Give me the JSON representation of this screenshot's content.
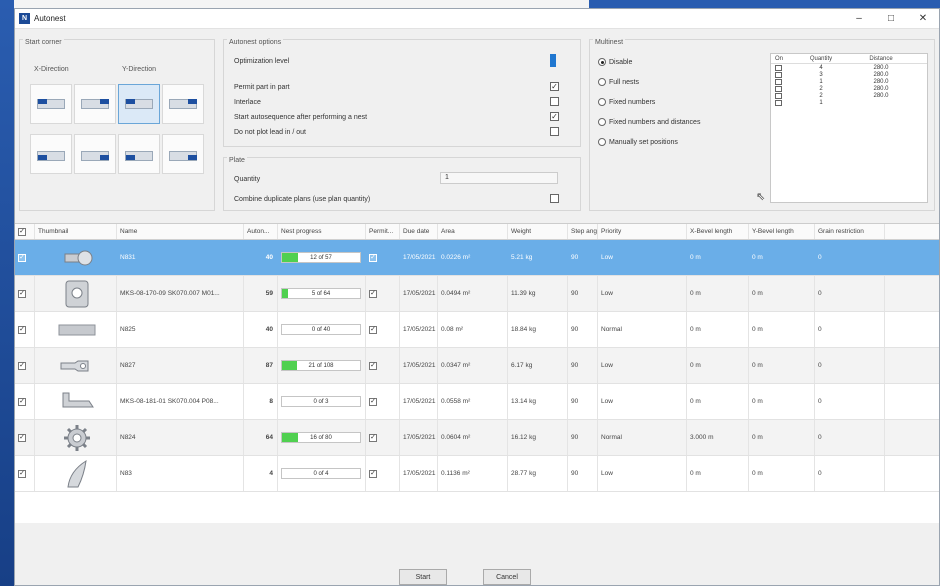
{
  "window": {
    "title": "Autonest",
    "icon_text": "N",
    "minimize": "–",
    "maximize": "□",
    "close": "✕"
  },
  "start_corner": {
    "label": "Start corner",
    "x_label": "X-Direction",
    "y_label": "Y-Direction"
  },
  "autonest_options": {
    "label": "Autonest options",
    "optimization_label": "Optimization level",
    "options": [
      {
        "label": "Permit part in part",
        "checked": true
      },
      {
        "label": "Interlace",
        "checked": false
      },
      {
        "label": "Start autosequence after performing a nest",
        "checked": true
      },
      {
        "label": "Do not plot lead in / out",
        "checked": false
      }
    ]
  },
  "plate": {
    "label": "Plate",
    "quantity_label": "Quantity",
    "quantity_value": "1",
    "combine_label": "Combine duplicate plans (use plan quantity)",
    "combine_checked": false
  },
  "multinest": {
    "label": "Multinest",
    "options": [
      {
        "label": "Disable",
        "selected": true
      },
      {
        "label": "Full nests",
        "selected": false
      },
      {
        "label": "Fixed numbers",
        "selected": false
      },
      {
        "label": "Fixed numbers and distances",
        "selected": false
      },
      {
        "label": "Manually set positions",
        "selected": false
      }
    ],
    "table": {
      "headers": [
        "On",
        "Quantity",
        "Distance"
      ],
      "rows": [
        {
          "qty": "4",
          "dist": "280.0"
        },
        {
          "qty": "3",
          "dist": "280.0"
        },
        {
          "qty": "1",
          "dist": "280.0"
        },
        {
          "qty": "2",
          "dist": "280.0"
        },
        {
          "qty": "2",
          "dist": "280.0"
        },
        {
          "qty": "1",
          "dist": ""
        }
      ]
    }
  },
  "parts": {
    "headers": [
      "Thumbnail",
      "Name",
      "Auton...",
      "Nest progress",
      "Permit...",
      "Due date",
      "Area",
      "Weight",
      "Step angle",
      "Priority",
      "X-Bevel length",
      "Y-Bevel length",
      "Grain restriction"
    ],
    "rows": [
      {
        "name": "N831",
        "auto": "40",
        "progress": "12 of 57",
        "fraction": 0.21,
        "due": "17/05/2021",
        "area": "0.0226 m²",
        "weight": "5.21 kg",
        "step": "90",
        "priority": "Low",
        "xbev": "0 m",
        "ybev": "0 m",
        "grain": "0"
      },
      {
        "name": "MKS-08-170-09 SK070.007 M01...",
        "auto": "59",
        "progress": "5 of 64",
        "fraction": 0.08,
        "due": "17/05/2021",
        "area": "0.0494 m²",
        "weight": "11.39 kg",
        "step": "90",
        "priority": "Low",
        "xbev": "0 m",
        "ybev": "0 m",
        "grain": "0"
      },
      {
        "name": "N825",
        "auto": "40",
        "progress": "0 of 40",
        "fraction": 0.0,
        "due": "17/05/2021",
        "area": "0.08 m²",
        "weight": "18.84 kg",
        "step": "90",
        "priority": "Normal",
        "xbev": "0 m",
        "ybev": "0 m",
        "grain": "0"
      },
      {
        "name": "N827",
        "auto": "87",
        "progress": "21 of 108",
        "fraction": 0.19,
        "due": "17/05/2021",
        "area": "0.0347 m²",
        "weight": "6.17 kg",
        "step": "90",
        "priority": "Low",
        "xbev": "0 m",
        "ybev": "0 m",
        "grain": "0"
      },
      {
        "name": "MKS-08-181-01 SK070.004 P08...",
        "auto": "8",
        "progress": "0 of 3",
        "fraction": 0.0,
        "due": "17/05/2021",
        "area": "0.0558 m²",
        "weight": "13.14 kg",
        "step": "90",
        "priority": "Low",
        "xbev": "0 m",
        "ybev": "0 m",
        "grain": "0"
      },
      {
        "name": "N824",
        "auto": "64",
        "progress": "16 of 80",
        "fraction": 0.2,
        "due": "17/05/2021",
        "area": "0.0604 m²",
        "weight": "16.12 kg",
        "step": "90",
        "priority": "Normal",
        "xbev": "3.000 m",
        "ybev": "0 m",
        "grain": "0"
      },
      {
        "name": "N83",
        "auto": "4",
        "progress": "0 of 4",
        "fraction": 0.0,
        "due": "17/05/2021",
        "area": "0.1136 m²",
        "weight": "28.77 kg",
        "step": "90",
        "priority": "Low",
        "xbev": "0 m",
        "ybev": "0 m",
        "grain": "0"
      }
    ]
  },
  "buttons": {
    "start": "Start",
    "cancel": "Cancel"
  }
}
